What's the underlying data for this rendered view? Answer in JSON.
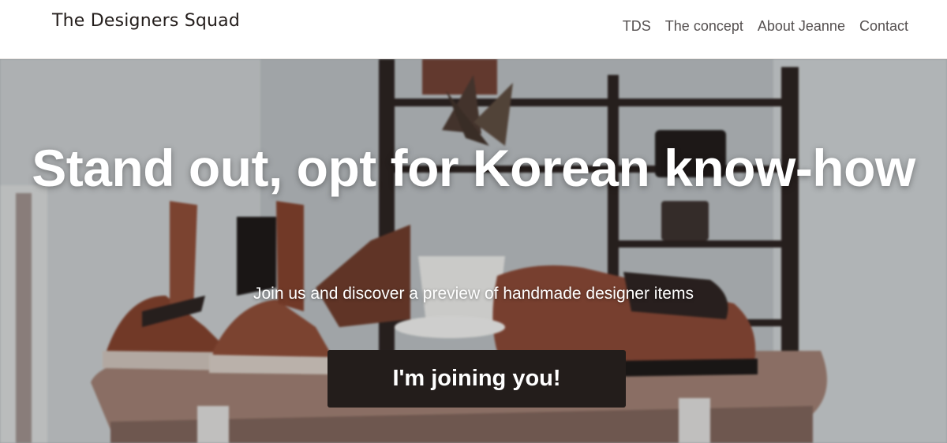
{
  "header": {
    "brand": "The Designers Squad",
    "nav": [
      {
        "label": "TDS"
      },
      {
        "label": "The concept"
      },
      {
        "label": "About Jeanne"
      },
      {
        "label": "Contact"
      }
    ]
  },
  "hero": {
    "title": "Stand out, opt for Korean know-how",
    "subtitle": "Join us and discover a preview of handmade designer items",
    "cta_label": "I'm joining you!",
    "background_description_colors": {
      "wall": "#b8bdc0",
      "shelf": "#2a211f",
      "leather": "#8a4a35",
      "table": "#9b7a6c"
    }
  },
  "theme": {
    "accent": "#231d1b",
    "text_light": "#ffffff",
    "nav_text": "#555050"
  }
}
